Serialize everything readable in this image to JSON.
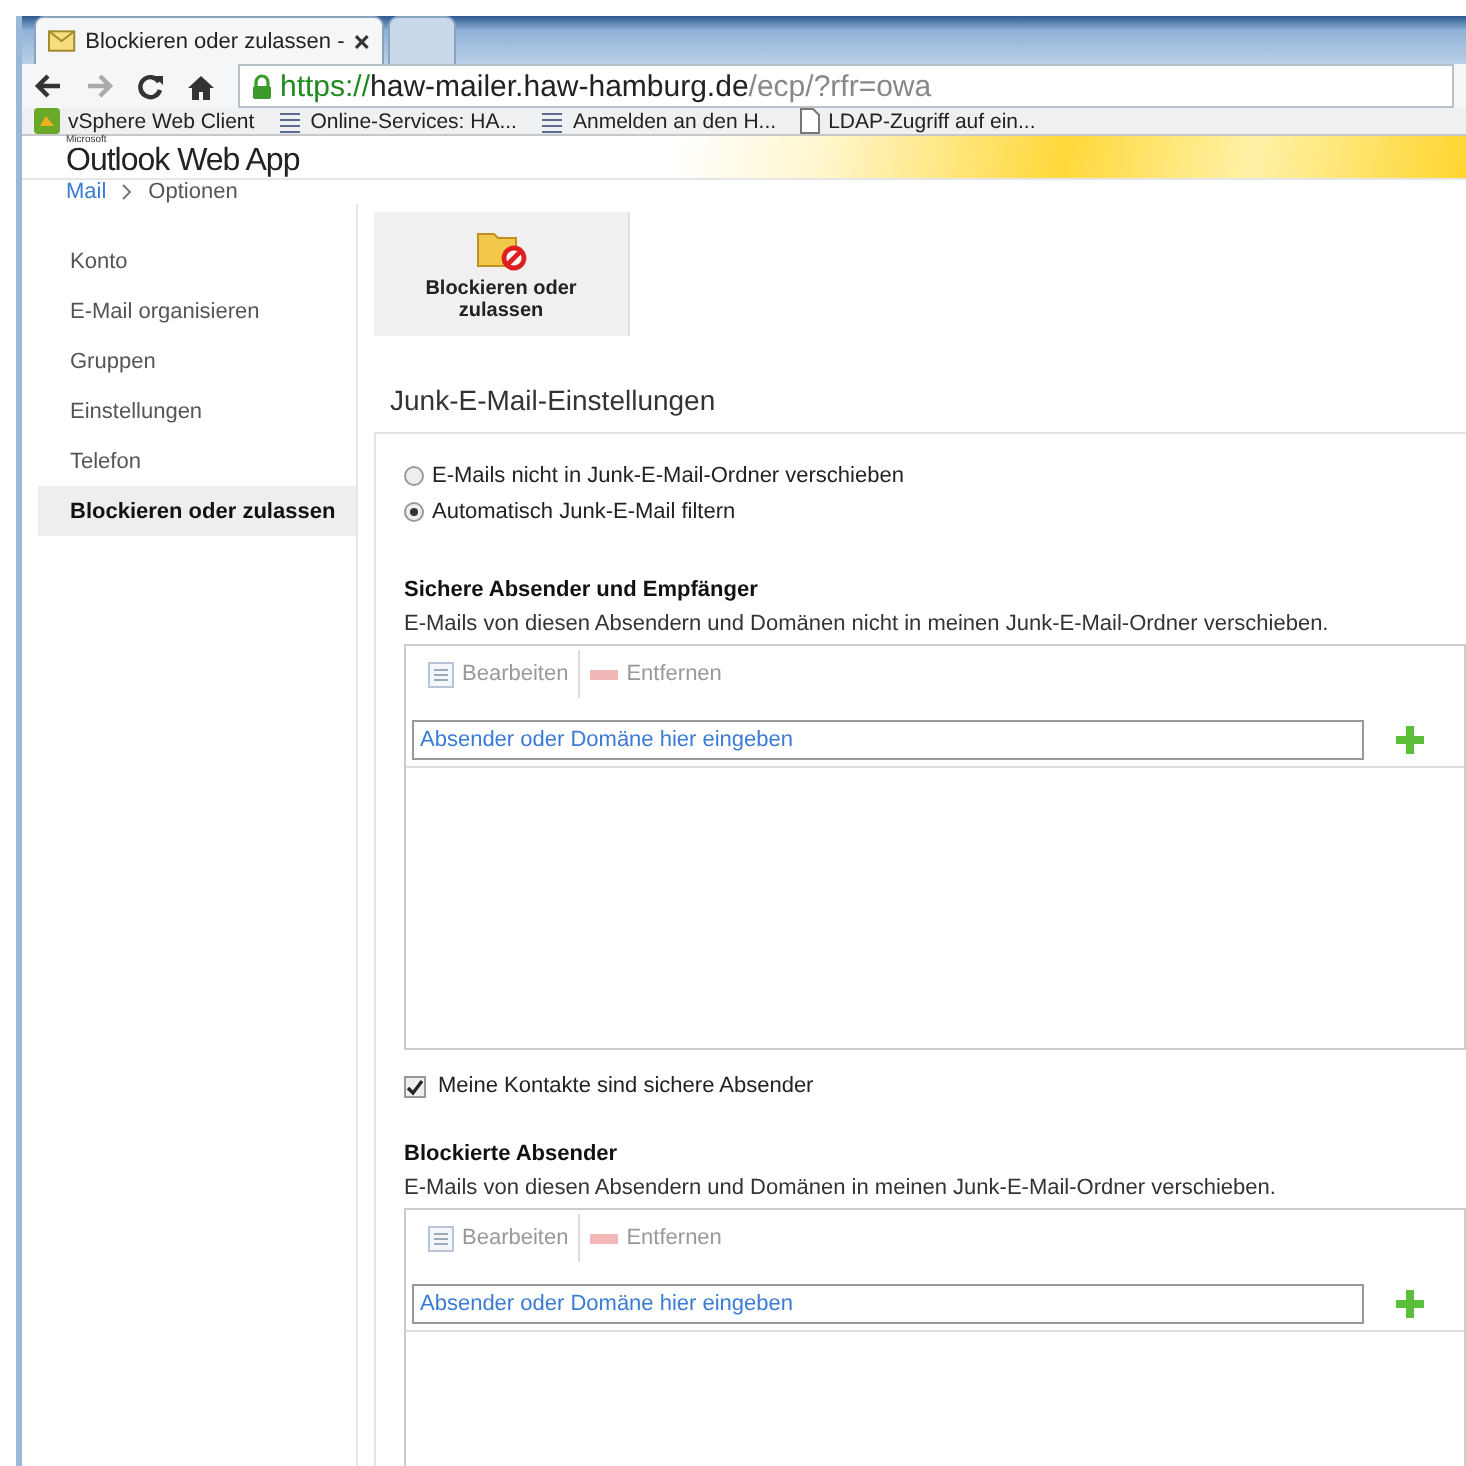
{
  "browser": {
    "tabs": [
      {
        "title": "Blockieren oder zulassen -",
        "selected": true
      }
    ],
    "url": {
      "scheme": "https://",
      "host": "haw-mailer.haw-hamburg.de",
      "path": "/ecp/?rfr=owa"
    },
    "bookmarks": [
      {
        "label": "vSphere Web Client",
        "kind": "app"
      },
      {
        "label": "Online-Services: HA...",
        "kind": "list"
      },
      {
        "label": "Anmelden an den H...",
        "kind": "list"
      },
      {
        "label": "LDAP-Zugriff auf ein...",
        "kind": "page"
      }
    ]
  },
  "header": {
    "vendor": "Microsoft",
    "product": "Outlook Web App"
  },
  "breadcrumb": [
    "Mail",
    "Optionen"
  ],
  "sidebar": {
    "items": [
      {
        "label": "Konto",
        "selected": false
      },
      {
        "label": "E-Mail organisieren",
        "selected": false
      },
      {
        "label": "Gruppen",
        "selected": false
      },
      {
        "label": "Einstellungen",
        "selected": false
      },
      {
        "label": "Telefon",
        "selected": false
      },
      {
        "label": "Blockieren oder zulassen",
        "selected": true
      }
    ]
  },
  "toolbar_button": {
    "label": "Blockieren oder zulassen"
  },
  "section_title": "Junk-E-Mail-Einstellungen",
  "radios": [
    {
      "label": "E-Mails nicht in Junk-E-Mail-Ordner verschieben",
      "selected": false
    },
    {
      "label": "Automatisch Junk-E-Mail filtern",
      "selected": true
    }
  ],
  "lists": [
    {
      "title": "Sichere Absender und Empfänger",
      "description": "E-Mails von diesen Absendern und Domänen nicht in meinen Junk-E-Mail-Ordner verschieben.",
      "actions": [
        {
          "label": "Bearbeiten",
          "kind": "edit",
          "disabled": true
        },
        {
          "label": "Entfernen",
          "kind": "remove",
          "disabled": true
        }
      ],
      "placeholder": "Absender oder Domäne hier eingeben",
      "checkbox": {
        "label": "Meine Kontakte sind sichere Absender",
        "checked": true
      }
    },
    {
      "title": "Blockierte Absender",
      "description": "E-Mails von diesen Absendern und Domänen in meinen Junk-E-Mail-Ordner verschieben.",
      "actions": [
        {
          "label": "Bearbeiten",
          "kind": "edit",
          "disabled": true
        },
        {
          "label": "Entfernen",
          "kind": "remove",
          "disabled": true
        }
      ],
      "placeholder": "Absender oder Domäne hier eingeben"
    }
  ]
}
